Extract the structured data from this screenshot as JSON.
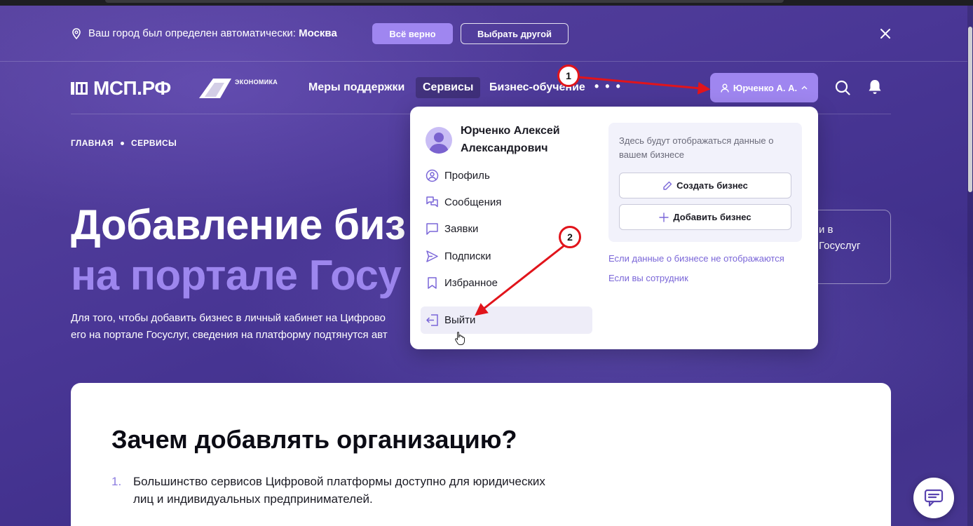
{
  "city_bar": {
    "prefix": "Ваш город был определен автоматически: ",
    "city": "Москва",
    "confirm_label": "Всё верно",
    "choose_label": "Выбрать другой"
  },
  "header": {
    "logo_text": "МСП.РФ",
    "partner_label": "ЭКОНОМИКА",
    "nav": [
      "Меры поддержки",
      "Сервисы",
      "Бизнес-обучение"
    ],
    "more": "• • •",
    "user_label": "Юрченко А. А."
  },
  "breadcrumb": {
    "home": "ГЛАВНАЯ",
    "current": "СЕРВИСЫ"
  },
  "hero": {
    "title_line1": "Добавление биз",
    "title_line2": "на портале Госу",
    "desc_line1": "Для того, чтобы добавить бизнес в личный кабинет на Цифрово",
    "desc_line2": "его на портале Госуслуг, сведения на платформу подтянутся авт",
    "side_line1": "и в",
    "side_line2": "Госуслуг"
  },
  "content": {
    "title": "Зачем добавлять организацию?",
    "item1_num": "1.",
    "item1_line1": "Большинство сервисов Цифровой платформы доступно для юридических",
    "item1_line2": "лиц и индивидуальных предпринимателей."
  },
  "dropdown": {
    "full_name_line1": "Юрченко Алексей",
    "full_name_line2": "Александрович",
    "menu": [
      "Профиль",
      "Сообщения",
      "Заявки",
      "Подписки",
      "Избранное"
    ],
    "logout": "Выйти",
    "biz_info": "Здесь будут отображаться данные о вашем бизнесе",
    "create_biz": "Создать бизнес",
    "add_biz": "Добавить бизнес",
    "link_not_shown": "Если данные о бизнесе не отображаются",
    "link_employee": "Если вы сотрудник"
  },
  "annotations": {
    "step1": "1",
    "step2": "2"
  },
  "colors": {
    "accent": "#9f86f0",
    "bg_purple": "#4a3796",
    "annotation_red": "#e1141b",
    "link": "#7a66d8"
  }
}
